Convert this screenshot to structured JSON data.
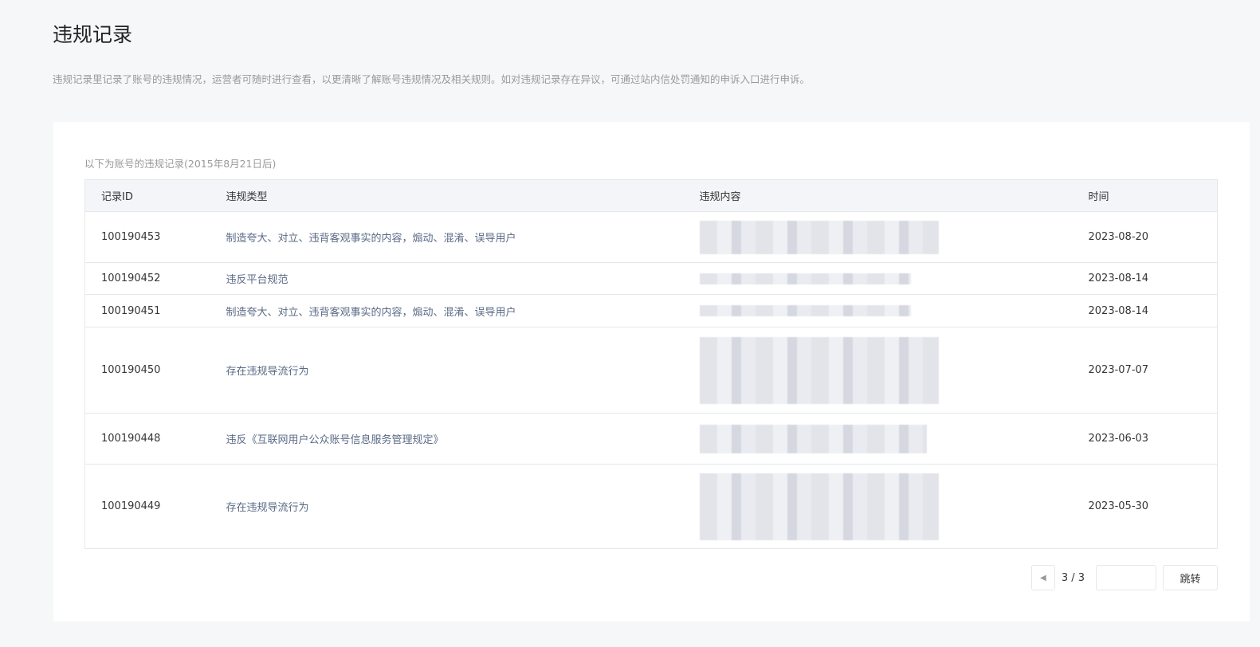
{
  "page": {
    "title": "违规记录",
    "description": "违规记录里记录了账号的违规情况，运营者可随时进行查看，以更清晰了解账号违规情况及相关规则。如对违规记录存在异议，可通过站内信处罚通知的申诉入口进行申诉。"
  },
  "card": {
    "subtitle": "以下为账号的违规记录(2015年8月21日后)"
  },
  "table": {
    "headers": [
      "记录ID",
      "违规类型",
      "违规内容",
      "时间"
    ],
    "rows": [
      {
        "id": "100190453",
        "type": "制造夸大、对立、违背客观事实的内容，煽动、混淆、误导用户",
        "date": "2023-08-20"
      },
      {
        "id": "100190452",
        "type": "违反平台规范",
        "date": "2023-08-14"
      },
      {
        "id": "100190451",
        "type": "制造夸大、对立、违背客观事实的内容，煽动、混淆、误导用户",
        "date": "2023-08-14"
      },
      {
        "id": "100190450",
        "type": "存在违规导流行为",
        "date": "2023-07-07"
      },
      {
        "id": "100190448",
        "type": "违反《互联网用户公众账号信息服务管理规定》",
        "date": "2023-06-03"
      },
      {
        "id": "100190449",
        "type": "存在违规导流行为",
        "date": "2023-05-30"
      }
    ]
  },
  "pagination": {
    "current": "3 / 3",
    "jump_label": "跳转",
    "input_value": ""
  }
}
